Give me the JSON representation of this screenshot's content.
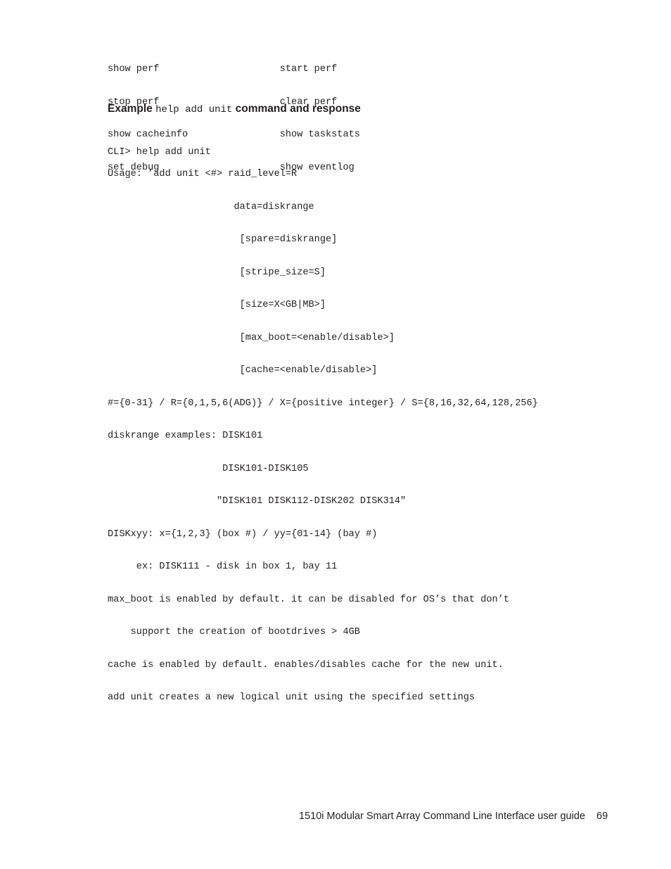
{
  "document": {
    "command_list": [
      "show perf                     start perf",
      "stop perf                     clear perf",
      "show cacheinfo                show taskstats",
      "set debug                     show eventlog"
    ],
    "example_heading": {
      "label": "Example",
      "command": "help add unit",
      "suffix": "command and response"
    },
    "cli_prompt": "CLI> help add unit",
    "usage_block": [
      "Usage: ’add unit <#> raid_level=R",
      "                      data=diskrange",
      "                       [spare=diskrange]",
      "                       [stripe_size=S]",
      "                       [size=X<GB|MB>]",
      "                       [max_boot=<enable/disable>]",
      "                       [cache=<enable/disable>]",
      "#={0-31} / R={0,1,5,6(ADG)} / X={positive integer} / S={8,16,32,64,128,256}",
      "diskrange examples: DISK101",
      "                    DISK101-DISK105",
      "                   \"DISK101 DISK112-DISK202 DISK314\"",
      "DISKxyy: x={1,2,3} (box #) / yy={01-14} (bay #)",
      "     ex: DISK111 - disk in box 1, bay 11",
      "max_boot is enabled by default. it can be disabled for OS’s that don’t",
      "    support the creation of bootdrives > 4GB",
      "cache is enabled by default. enables/disables cache for the new unit.",
      "add unit creates a new logical unit using the specified settings"
    ],
    "footer": {
      "title": "1510i Modular Smart Array Command Line Interface user guide",
      "page_number": "69"
    }
  }
}
